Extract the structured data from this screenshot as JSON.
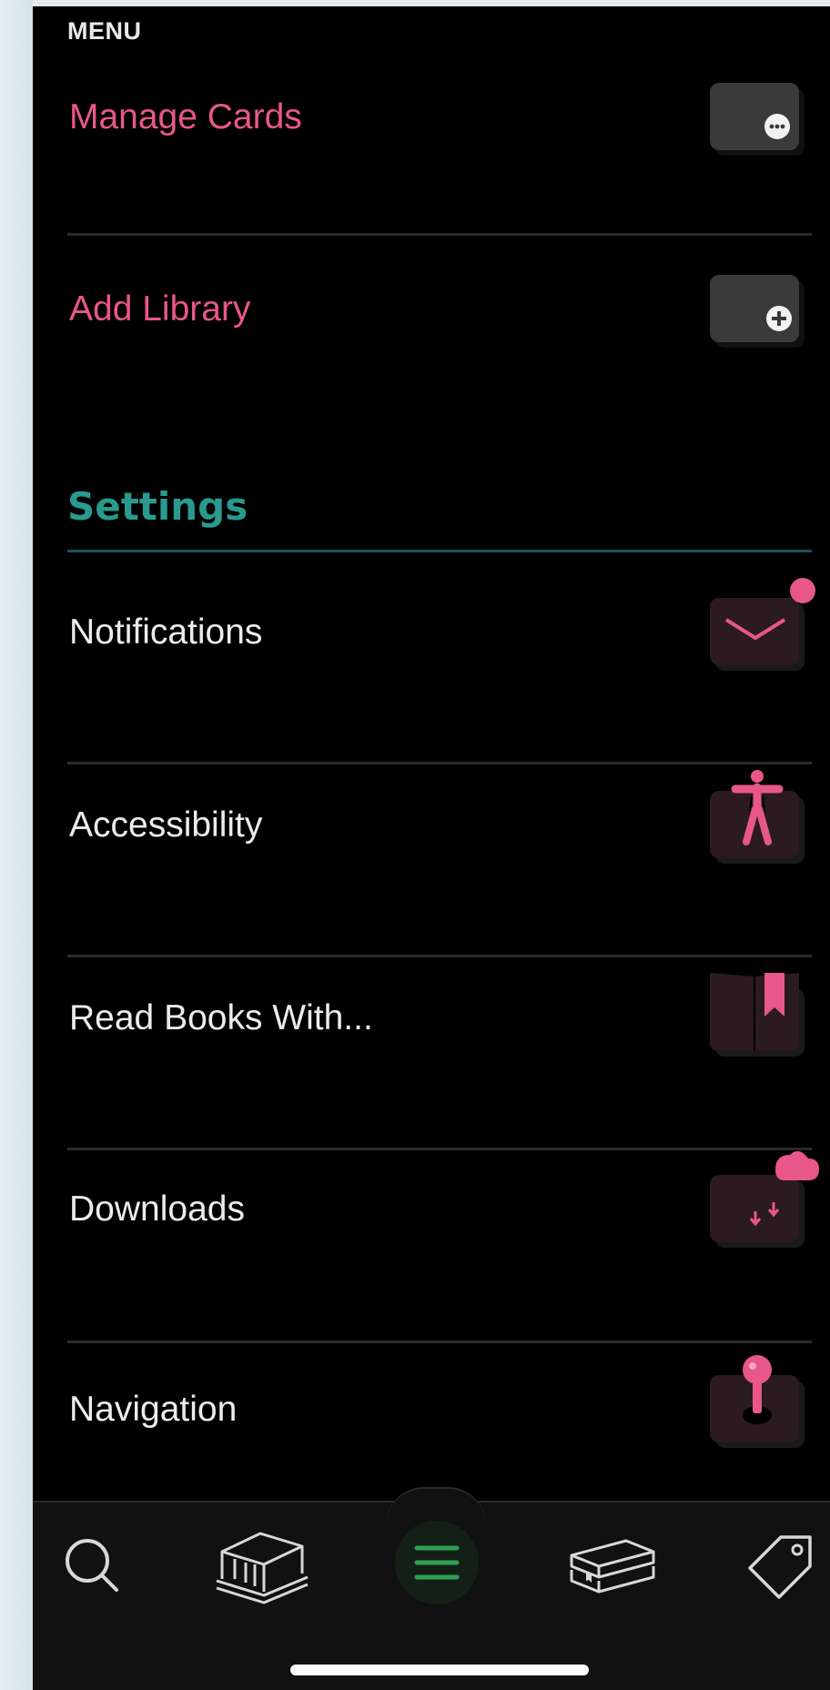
{
  "menu": {
    "title": "MENU"
  },
  "account_rows": [
    {
      "label": "Manage Cards",
      "icon": "more-icon"
    },
    {
      "label": "Add Library",
      "icon": "plus-icon"
    }
  ],
  "settings": {
    "heading": "Settings",
    "rows": [
      {
        "label": "Notifications",
        "icon": "envelope-icon"
      },
      {
        "label": "Accessibility",
        "icon": "accessibility-icon"
      },
      {
        "label": "Read Books With...",
        "icon": "book-bookmark-icon"
      },
      {
        "label": "Downloads",
        "icon": "cloud-download-icon"
      },
      {
        "label": "Navigation",
        "icon": "joystick-icon"
      }
    ]
  },
  "tabbar": {
    "tabs": [
      {
        "name": "search",
        "icon": "search-icon"
      },
      {
        "name": "library",
        "icon": "library-building-icon"
      },
      {
        "name": "menu",
        "icon": "menu-icon",
        "active": true
      },
      {
        "name": "shelf",
        "icon": "books-stack-icon"
      },
      {
        "name": "tags",
        "icon": "tag-icon"
      }
    ]
  },
  "colors": {
    "accent_pink": "#e8578a",
    "settings_teal": "#2a9a8e",
    "active_tab_green": "#2f9e56",
    "background": "#000000"
  }
}
